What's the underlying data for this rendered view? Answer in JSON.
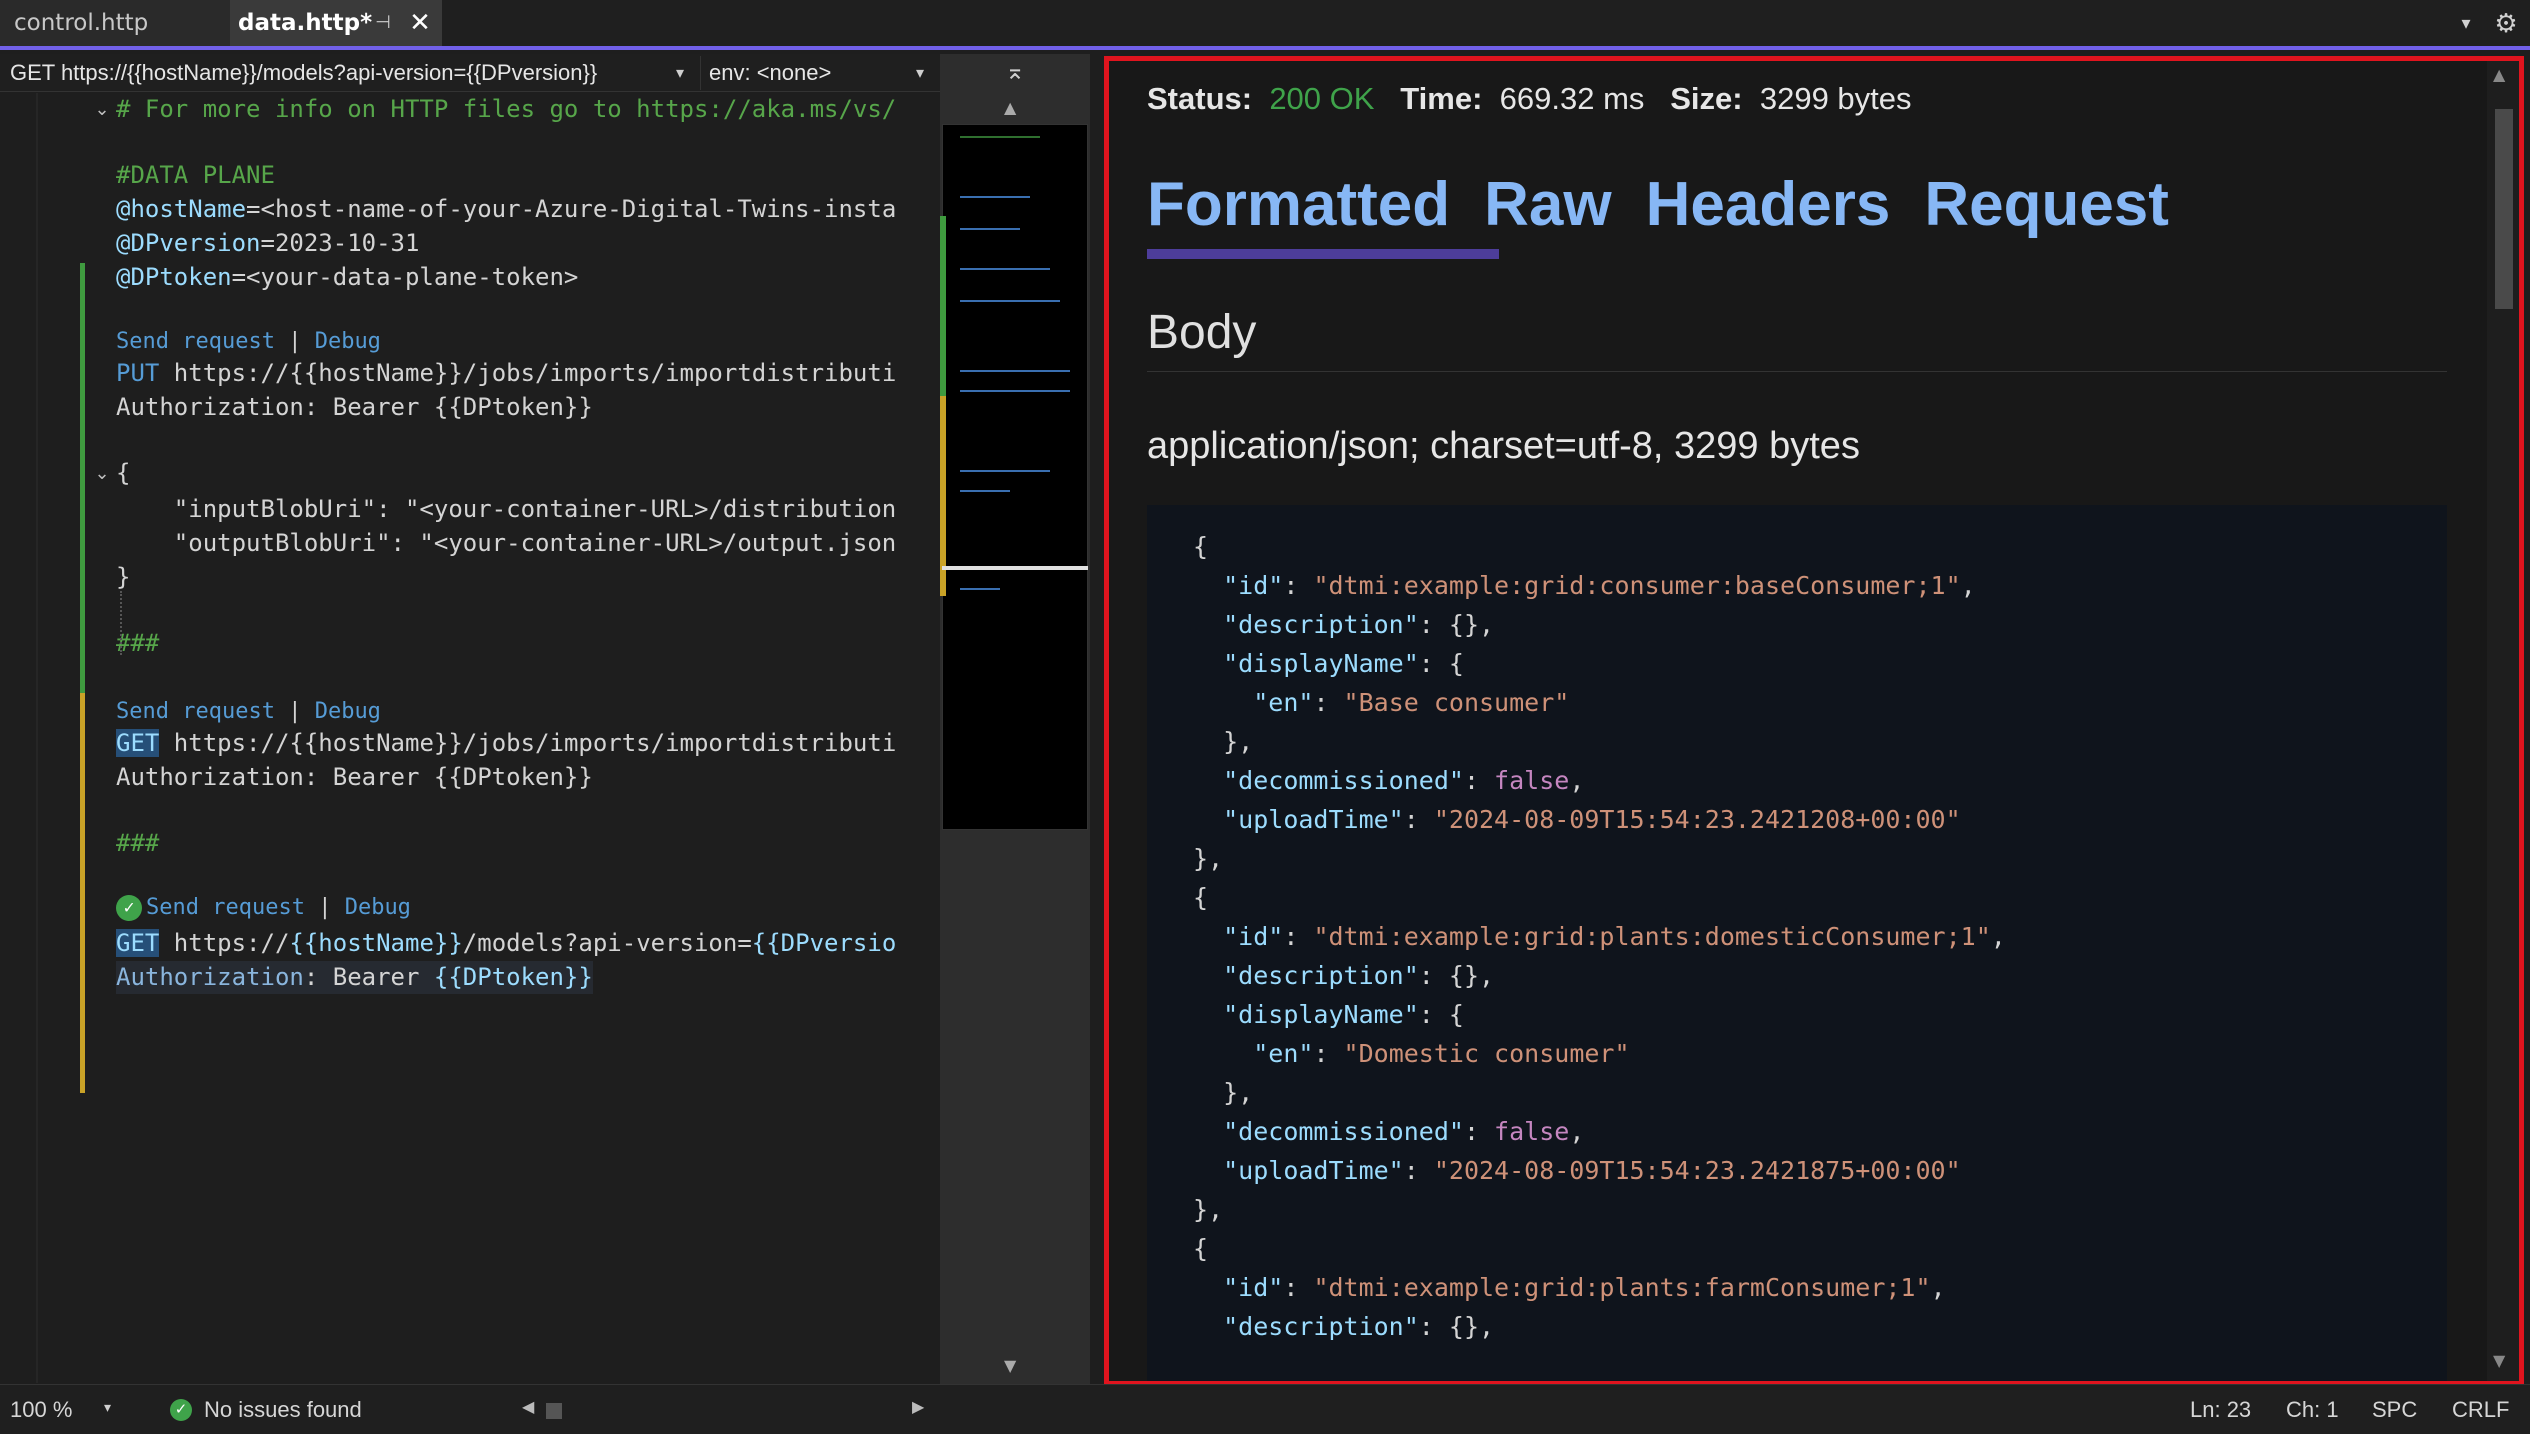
{
  "tabs": [
    {
      "label": "control.http"
    },
    {
      "label": "data.http*"
    }
  ],
  "icons": {
    "pin": "pin-icon",
    "close": "close-icon",
    "dropdown": "chevron-down-icon",
    "settings": "gear-icon"
  },
  "request_selector": {
    "value": "GET https://{{hostName}}/models?api-version={{DPversion}}"
  },
  "env_selector": {
    "value": "env: <none>"
  },
  "editor": {
    "line1": "# For more info on HTTP files go to https://aka.ms/vs/",
    "line3": "#DATA PLANE",
    "host_var": "@hostName",
    "host_val": "=<host-name-of-your-Azure-Digital-Twins-insta",
    "dpv_var": "@DPversion",
    "dpv_val": "=2023-10-31",
    "dpt_var": "@DPtoken",
    "dpt_val": "=<your-data-plane-token>",
    "send": "Send request",
    "sep": " | ",
    "debug": "Debug",
    "put_method": "PUT",
    "put_url": " https://{{hostName}}/jobs/imports/importdistributi",
    "auth1": "Authorization: Bearer {{DPtoken}}",
    "brace_open": "{",
    "input_blob": "    \"inputBlobUri\": \"<your-container-URL>/distribution",
    "output_blob": "    \"outputBlobUri\": \"<your-container-URL>/output.json",
    "brace_close": "}",
    "hashes": "###",
    "get_method": "GET",
    "get_url": " https://{{hostName}}/jobs/imports/importdistributi",
    "auth2": "Authorization: Bearer {{DPtoken}}",
    "hashes2": "###",
    "get2_method": "GET",
    "get2_url_a": " https://",
    "get2_url_b": "{{hostName}}",
    "get2_url_c": "/models?api-version=",
    "get2_url_d": "{{DPversio",
    "auth3_key": "Authorization",
    "auth3_mid": ": Bearer ",
    "auth3_tok": "{{DPtoken}}"
  },
  "response": {
    "status_label": "Status:",
    "status_value": "200 OK",
    "time_label": "Time:",
    "time_value": "669.32 ms",
    "size_label": "Size:",
    "size_value": "3299 bytes",
    "tabs": [
      "Formatted",
      "Raw",
      "Headers",
      "Request"
    ],
    "section_title": "Body",
    "content_type": "application/json; charset=utf-8, 3299 bytes",
    "json": {
      "items": [
        {
          "id": "\"dtmi:example:grid:consumer:baseConsumer;1\"",
          "description": "{}",
          "en": "\"Base consumer\"",
          "decommissioned": "false",
          "uploadTime": "\"2024-08-09T15:54:23.2421208+00:00\""
        },
        {
          "id": "\"dtmi:example:grid:plants:domesticConsumer;1\"",
          "description": "{}",
          "en": "\"Domestic consumer\"",
          "decommissioned": "false",
          "uploadTime": "\"2024-08-09T15:54:23.2421875+00:00\""
        },
        {
          "id": "\"dtmi:example:grid:plants:farmConsumer;1\"",
          "description": "{}"
        }
      ],
      "keys": {
        "id": "\"id\"",
        "description": "\"description\"",
        "displayName": "\"displayName\"",
        "en": "\"en\"",
        "decommissioned": "\"decommissioned\"",
        "uploadTime": "\"uploadTime\""
      }
    }
  },
  "statusbar": {
    "zoom": "100 %",
    "issues": "No issues found",
    "ln": "Ln: 23",
    "ch": "Ch: 1",
    "spc": "SPC",
    "crlf": "CRLF"
  },
  "colors": {
    "accent": "#7160e8",
    "highlight_border": "#e0141e",
    "status_ok": "#3fa34a"
  }
}
